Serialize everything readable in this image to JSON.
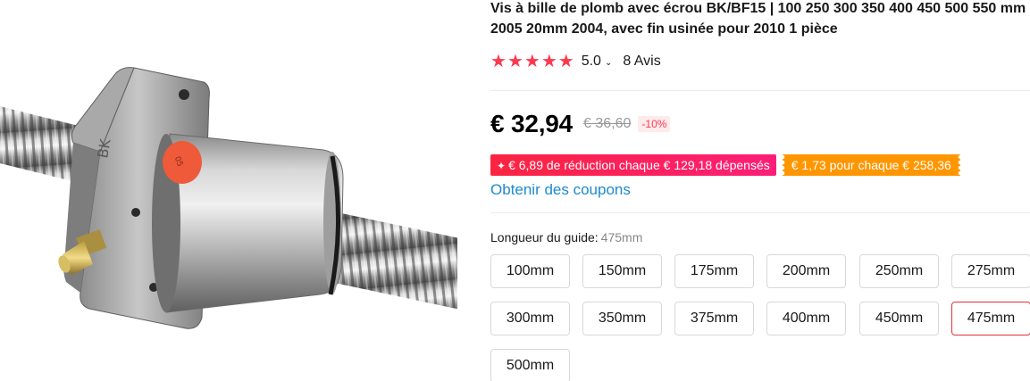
{
  "product": {
    "title": "Vis à bille de plomb avec écrou BK/BF15 | 100 250 300 350 400 450 500 550 mm 2005 20mm 2004, avec fin usinée pour 2010 1 pièce",
    "image_alt": "ball screw nut"
  },
  "rating": {
    "stars": 5,
    "score": "5.0",
    "reviews": "8 Avis",
    "star_color": "#fd384f"
  },
  "price": {
    "current": "€ 32,94",
    "original": "€ 36,60",
    "discount": "-10%"
  },
  "promotions": {
    "red_badge": "€ 6,89 de réduction chaque € 129,18 dépensés",
    "orange_badge": "€ 1,73 pour chaque € 258,36"
  },
  "coupons_link": "Obtenir des coupons",
  "guide": {
    "label": "Longueur du guide:",
    "selected": "475mm",
    "options": [
      {
        "label": "100mm",
        "selected": false
      },
      {
        "label": "150mm",
        "selected": false
      },
      {
        "label": "175mm",
        "selected": false
      },
      {
        "label": "200mm",
        "selected": false
      },
      {
        "label": "250mm",
        "selected": false
      },
      {
        "label": "275mm",
        "selected": false
      },
      {
        "label": "300mm",
        "selected": false
      },
      {
        "label": "350mm",
        "selected": false
      },
      {
        "label": "375mm",
        "selected": false
      },
      {
        "label": "400mm",
        "selected": false
      },
      {
        "label": "450mm",
        "selected": false
      },
      {
        "label": "475mm",
        "selected": true
      },
      {
        "label": "500mm",
        "selected": false
      }
    ]
  },
  "colors": {
    "accent_red": "#fd384f",
    "link_blue": "#1c8ad1",
    "promo_orange": "#ff9600"
  }
}
